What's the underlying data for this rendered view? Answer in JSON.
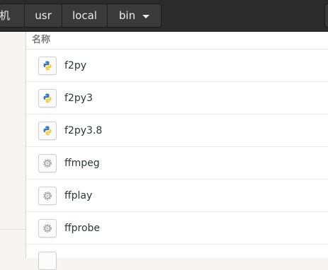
{
  "header": {
    "breadcrumbs": [
      {
        "label": "机"
      },
      {
        "label": "usr"
      },
      {
        "label": "local"
      },
      {
        "label": "bin"
      }
    ]
  },
  "list": {
    "column_name": "名称",
    "files": [
      {
        "name": "f2py",
        "icon": "python-script-icon"
      },
      {
        "name": "f2py3",
        "icon": "python-script-icon"
      },
      {
        "name": "f2py3.8",
        "icon": "python-script-icon"
      },
      {
        "name": "ffmpeg",
        "icon": "executable-gear-icon"
      },
      {
        "name": "ffplay",
        "icon": "executable-gear-icon"
      },
      {
        "name": "ffprobe",
        "icon": "executable-gear-icon"
      }
    ]
  },
  "colors": {
    "header_bg": "#2b2b2b",
    "python_blue": "#3b78b4",
    "python_yellow": "#f5cf3a",
    "gear_gray": "#9a9a9a"
  }
}
